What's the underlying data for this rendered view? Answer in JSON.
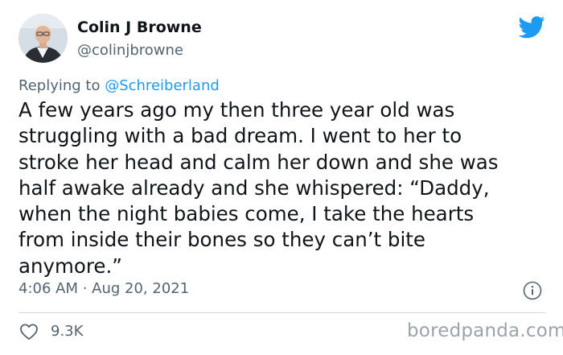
{
  "author": {
    "display_name": "Colin J Browne",
    "handle": "@colinjbrowne"
  },
  "reply": {
    "prefix": "Replying to ",
    "mention": "@Schreiberland"
  },
  "tweet": {
    "text": "A few years ago my then three year old was\nstruggling with a bad dream. I went to her to\nstroke her head and calm her down and she was\nhalf awake already and she whispered: “Daddy,\nwhen the night babies come, I take the hearts\nfrom inside their bones so they can’t bite\nanymore.”",
    "timestamp": "4:06 AM · Aug 20, 2021"
  },
  "engagement": {
    "likes": "9.3K"
  },
  "watermark": "boredpanda.com",
  "icons": {
    "brand": "twitter-bird-icon",
    "info": "info-icon",
    "like": "heart-icon"
  },
  "colors": {
    "brand_blue": "#1d9bf0",
    "text_primary": "#0f1419",
    "text_secondary": "#536471",
    "divider": "#cfd9de",
    "watermark": "#9aa4ab"
  }
}
